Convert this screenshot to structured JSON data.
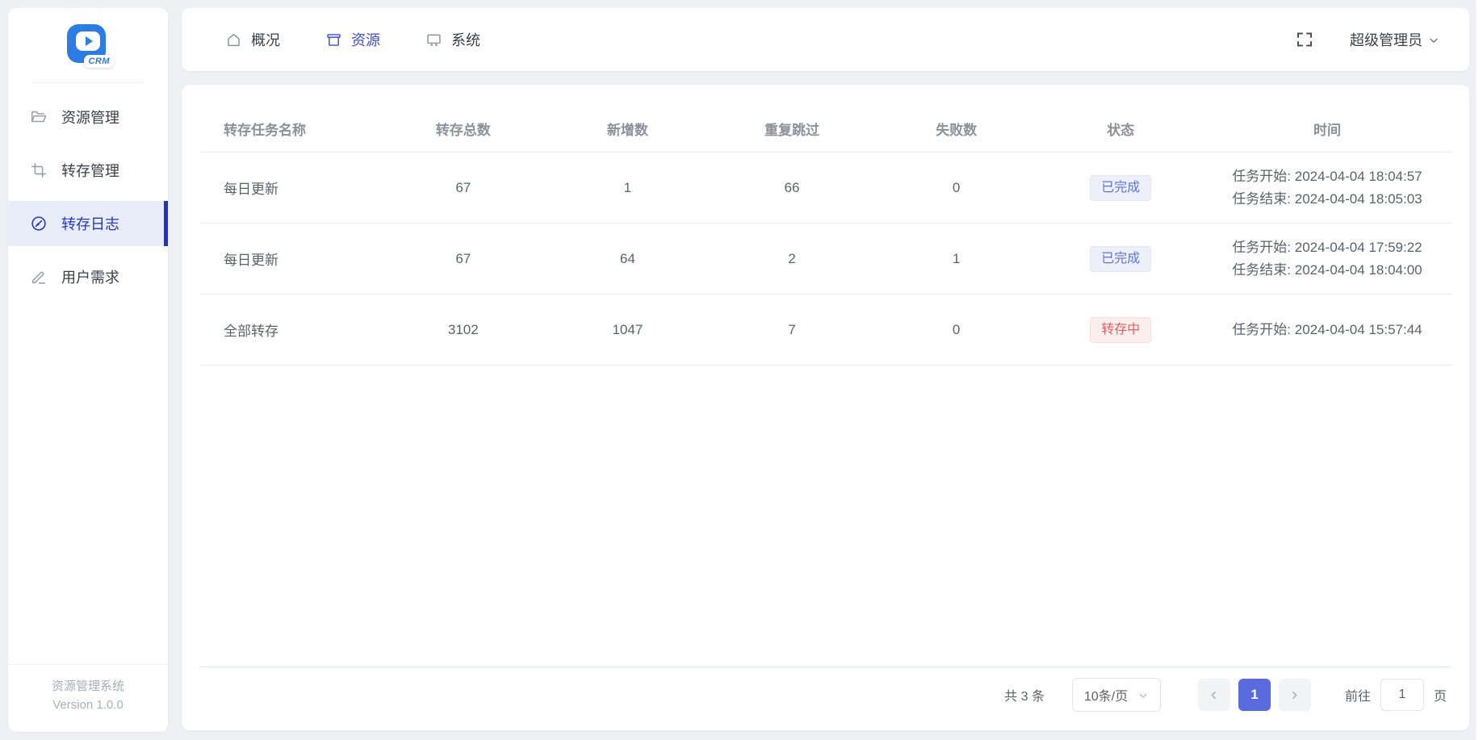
{
  "app": {
    "brand": "CRM",
    "footer_title": "资源管理系统",
    "footer_version": "Version 1.0.0"
  },
  "colors": {
    "primary_indigo": "#5a6be0",
    "sidebar_active_text": "#2336cb",
    "sidebar_active_bg": "#e9edfa",
    "logo_blue": "#2b7de3",
    "nav_active": "#3b51d2",
    "badge_done_text": "#5f74db",
    "badge_done_bg": "#edf0fb",
    "badge_running_text": "#e26161",
    "badge_running_bg": "#fdeeee",
    "page_bg": "#eef0f4"
  },
  "sidebar": {
    "items": [
      {
        "label": "资源管理",
        "icon": "folder-icon",
        "active": false
      },
      {
        "label": "转存管理",
        "icon": "crop-icon",
        "active": false
      },
      {
        "label": "转存日志",
        "icon": "compass-icon",
        "active": true
      },
      {
        "label": "用户需求",
        "icon": "pencil-icon",
        "active": false
      }
    ]
  },
  "topnav": {
    "tabs": [
      {
        "label": "概况",
        "icon": "home-icon",
        "active": false
      },
      {
        "label": "资源",
        "icon": "box-icon",
        "active": true
      },
      {
        "label": "系统",
        "icon": "monitor-icon",
        "active": false
      }
    ],
    "user": "超级管理员"
  },
  "table": {
    "headers": [
      "转存任务名称",
      "转存总数",
      "新增数",
      "重复跳过",
      "失败数",
      "状态",
      "时间"
    ],
    "rows": [
      {
        "name": "每日更新",
        "total": "67",
        "added": "1",
        "skipped": "66",
        "failed": "0",
        "status": "已完成",
        "status_type": "done",
        "t1": "任务开始: 2024-04-04 18:04:57",
        "t2": "任务结束: 2024-04-04 18:05:03"
      },
      {
        "name": "每日更新",
        "total": "67",
        "added": "64",
        "skipped": "2",
        "failed": "1",
        "status": "已完成",
        "status_type": "done",
        "t1": "任务开始: 2024-04-04 17:59:22",
        "t2": "任务结束: 2024-04-04 18:04:00"
      },
      {
        "name": "全部转存",
        "total": "3102",
        "added": "1047",
        "skipped": "7",
        "failed": "0",
        "status": "转存中",
        "status_type": "running",
        "t1": "任务开始: 2024-04-04 15:57:44"
      }
    ]
  },
  "pagination": {
    "total_label": "共 3 条",
    "page_size": "10条/页",
    "current_page": "1",
    "goto_label": "前往",
    "goto_value": "1",
    "page_suffix": "页"
  }
}
